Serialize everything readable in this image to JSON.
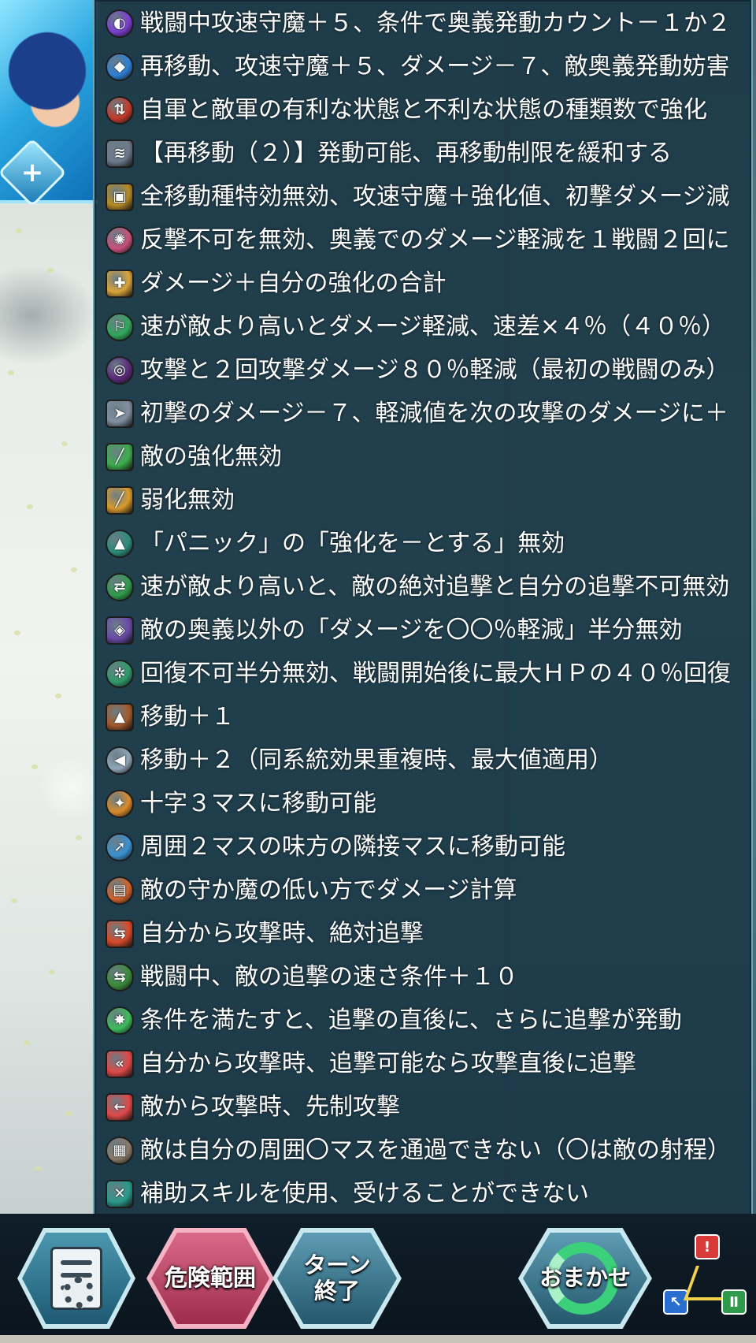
{
  "skills": [
    {
      "icon": "rainbow-orb-icon",
      "text": "戦闘中攻速守魔＋５、条件で奥義発動カウント－１か２",
      "color": "#7a3fd0"
    },
    {
      "icon": "blue-flame-icon",
      "text": "再移動、攻速守魔＋５、ダメージ－７、敵奥義発動妨害",
      "color": "#2d7fd6"
    },
    {
      "icon": "red-green-arrows-icon",
      "text": "自軍と敵軍の有利な状態と不利な状態の種類数で強化",
      "color": "#c23a2a"
    },
    {
      "icon": "footprints-icon",
      "text": "【再移動（２）】発動可能、再移動制限を緩和する",
      "color": "#6d7a8a"
    },
    {
      "icon": "gold-shield-icon",
      "text": "全移動種特効無効、攻速守魔＋強化値、初撃ダメージ減",
      "color": "#b58a25"
    },
    {
      "icon": "pink-burst-icon",
      "text": "反撃不可を無効、奥義でのダメージ軽減を１戦闘２回に",
      "color": "#c8507a"
    },
    {
      "icon": "sword-plus-icon",
      "text": "ダメージ＋自分の強化の合計",
      "color": "#d9a43a"
    },
    {
      "icon": "running-man-icon",
      "text": "速が敵より高いとダメージ軽減、速差×４％（４０％）",
      "color": "#2fa65a"
    },
    {
      "icon": "purple-vortex-icon",
      "text": "攻撃と２回攻撃ダメージ８０％軽減（最初の戦闘のみ）",
      "color": "#5b2a7a"
    },
    {
      "icon": "shield-dash-icon",
      "text": "初撃のダメージ－７、軽減値を次の攻撃のダメージに＋",
      "color": "#7f8fa0"
    },
    {
      "icon": "green-slash-icon",
      "text": "敵の強化無効",
      "color": "#3cae4c"
    },
    {
      "icon": "gold-slash-icon",
      "text": "弱化無効",
      "color": "#d89a2c"
    },
    {
      "icon": "eye-warning-icon",
      "text": "「パニック」の「強化を－とする」無効",
      "color": "#2a8c7a"
    },
    {
      "icon": "red-arrows-icon",
      "text": "速が敵より高いと、敵の絶対追撃と自分の追撃不可無効",
      "color": "#2e9a4a"
    },
    {
      "icon": "purple-shield-icon",
      "text": "敵の奥義以外の「ダメージを〇〇％軽減」半分無効",
      "color": "#6a4ba8"
    },
    {
      "icon": "green-heal-icon",
      "text": "回復不可半分無効、戦闘開始後に最大ＨＰの４０％回復",
      "color": "#2f9a6a"
    },
    {
      "icon": "boot-icon",
      "text": "移動＋１",
      "color": "#a35a2a"
    },
    {
      "icon": "wing-boot-icon",
      "text": "移動＋２（同系統効果重複時、最大値適用）",
      "color": "#8fa6b8"
    },
    {
      "icon": "cross-move-icon",
      "text": "十字３マスに移動可能",
      "color": "#d88a2a"
    },
    {
      "icon": "warp-icon",
      "text": "周囲２マスの味方の隣接マスに移動可能",
      "color": "#3a8fd0"
    },
    {
      "icon": "orange-book-icon",
      "text": "敵の守か魔の低い方でダメージ計算",
      "color": "#d0632a"
    },
    {
      "icon": "double-arrow-icon",
      "text": "自分から攻撃時、絶対追撃",
      "color": "#d84a2a"
    },
    {
      "icon": "speed-runner-icon",
      "text": "戦闘中、敵の追撃の速さ条件＋１０",
      "color": "#3a8a3a"
    },
    {
      "icon": "green-star-icon",
      "text": "条件を満たすと、追撃の直後に、さらに追撃が発動",
      "color": "#3cbc5a"
    },
    {
      "icon": "double-chevron-icon",
      "text": "自分から攻撃時、追撃可能なら攻撃直後に追撃",
      "color": "#e04848"
    },
    {
      "icon": "dot-arrow-icon",
      "text": "敵から攻撃時、先制攻撃",
      "color": "#e04848"
    },
    {
      "icon": "brick-wall-icon",
      "text": "敵は自分の周囲〇マスを通過できない（〇は敵の射程）",
      "color": "#8a7a6a"
    },
    {
      "icon": "no-assist-icon",
      "text": "補助スキルを使用、受けることができない",
      "color": "#2a9a8a"
    }
  ],
  "bottom_bar": {
    "danger_label": "危険範囲",
    "turn_end_line1": "ターン",
    "turn_end_line2": "終了",
    "auto_label": "おまかせ"
  },
  "colors": {
    "panel_bg": "#183442",
    "danger_accent": "#d96a87",
    "auto_accent": "#3bd07a"
  }
}
